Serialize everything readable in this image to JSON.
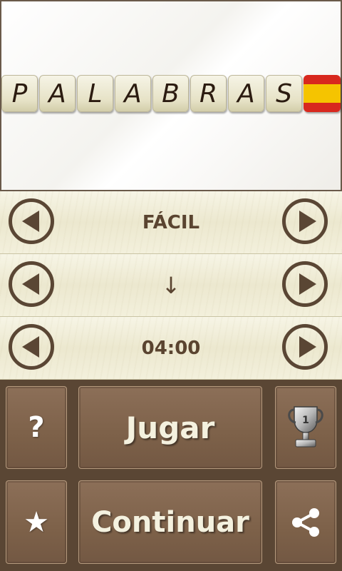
{
  "header": {
    "tiles": [
      "P",
      "A",
      "L",
      "A",
      "B",
      "R",
      "A",
      "S"
    ]
  },
  "settings": {
    "difficulty": "FÁCIL",
    "direction": "↓",
    "time": "04:00"
  },
  "buttons": {
    "help": "?",
    "play": "Jugar",
    "favorites": "★",
    "continue": "Continuar"
  },
  "colors": {
    "accent": "#5a4634",
    "button": "#7d6149",
    "flag_red": "#d8281e",
    "flag_yellow": "#f5c400"
  }
}
